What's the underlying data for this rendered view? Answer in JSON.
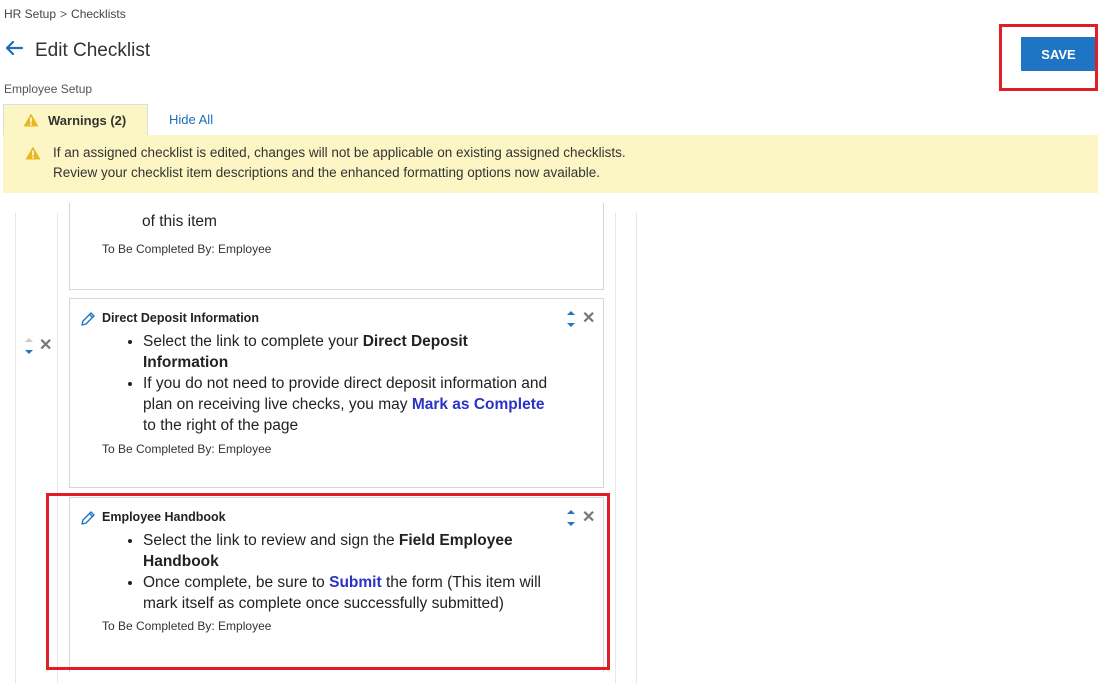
{
  "breadcrumb": {
    "items": [
      "HR Setup",
      "Checklists"
    ],
    "separator": ">"
  },
  "header": {
    "title": "Edit Checklist",
    "save_label": "SAVE"
  },
  "subtitle": "Employee Setup",
  "tabs": {
    "warnings_label": "Warnings (2)",
    "hide_all_label": "Hide All"
  },
  "warnings": [
    "If an assigned checklist is edited, changes will not be applicable on existing assigned checklists.",
    "Review your checklist item descriptions and the enhanced formatting options now available."
  ],
  "items": [
    {
      "partial_text": "of this item",
      "completed_by": "To Be Completed By: Employee"
    },
    {
      "title": "Direct Deposit Information",
      "bullets": [
        {
          "pre": "Select the link to complete your ",
          "bold": "Direct Deposit Information",
          "post": ""
        },
        {
          "pre": "If you do not need to provide direct deposit information and plan on receiving live checks, you may ",
          "link": "Mark as Complete",
          "post": " to the right of the page"
        }
      ],
      "completed_by": "To Be Completed By: Employee"
    },
    {
      "title": "Employee Handbook",
      "bullets": [
        {
          "pre": "Select the link to review and sign the ",
          "bold": "Field Employee Handbook",
          "post": ""
        },
        {
          "pre": "Once complete, be sure to ",
          "link": "Submit",
          "post": " the form (This item will mark itself as complete once successfully submitted)"
        }
      ],
      "completed_by": "To Be Completed By: Employee"
    }
  ],
  "colors": {
    "accent": "#1d75c4",
    "warning_bg": "#fbf6c4",
    "highlight": "#e01e25",
    "link": "#2a33c8"
  }
}
